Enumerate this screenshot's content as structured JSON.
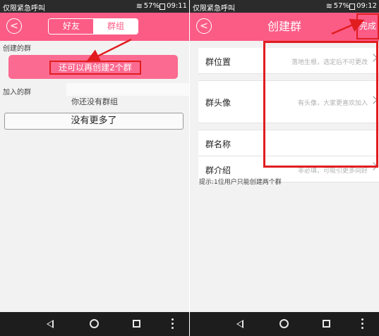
{
  "left": {
    "status": {
      "carrier": "仅限紧急呼叫",
      "battery": "57%",
      "time": "09:11"
    },
    "tabs": [
      {
        "label": "好友"
      },
      {
        "label": "群组"
      }
    ],
    "created_section": "创建的群",
    "quota_text": "还可以再创建2个群",
    "joined_section": "加入的群",
    "empty_text": "你还没有群组",
    "no_more": "没有更多了"
  },
  "right": {
    "status": {
      "carrier": "仅限紧急呼叫",
      "battery": "57%",
      "time": "09:12"
    },
    "title": "创建群",
    "done": "完成",
    "rows": [
      {
        "label": "群位置",
        "hint": "落地生根，选定后不可更改"
      },
      {
        "label": "群头像",
        "hint": "有头像，大家更喜欢加入"
      },
      {
        "label": "群名称",
        "hint": ""
      },
      {
        "label": "群介绍",
        "hint": "非必填，可吸引更多同好"
      }
    ],
    "tip": "提示:1位用户只能创建两个群"
  },
  "colors": {
    "accent": "#fb5c86",
    "annotation": "#e11d20"
  }
}
